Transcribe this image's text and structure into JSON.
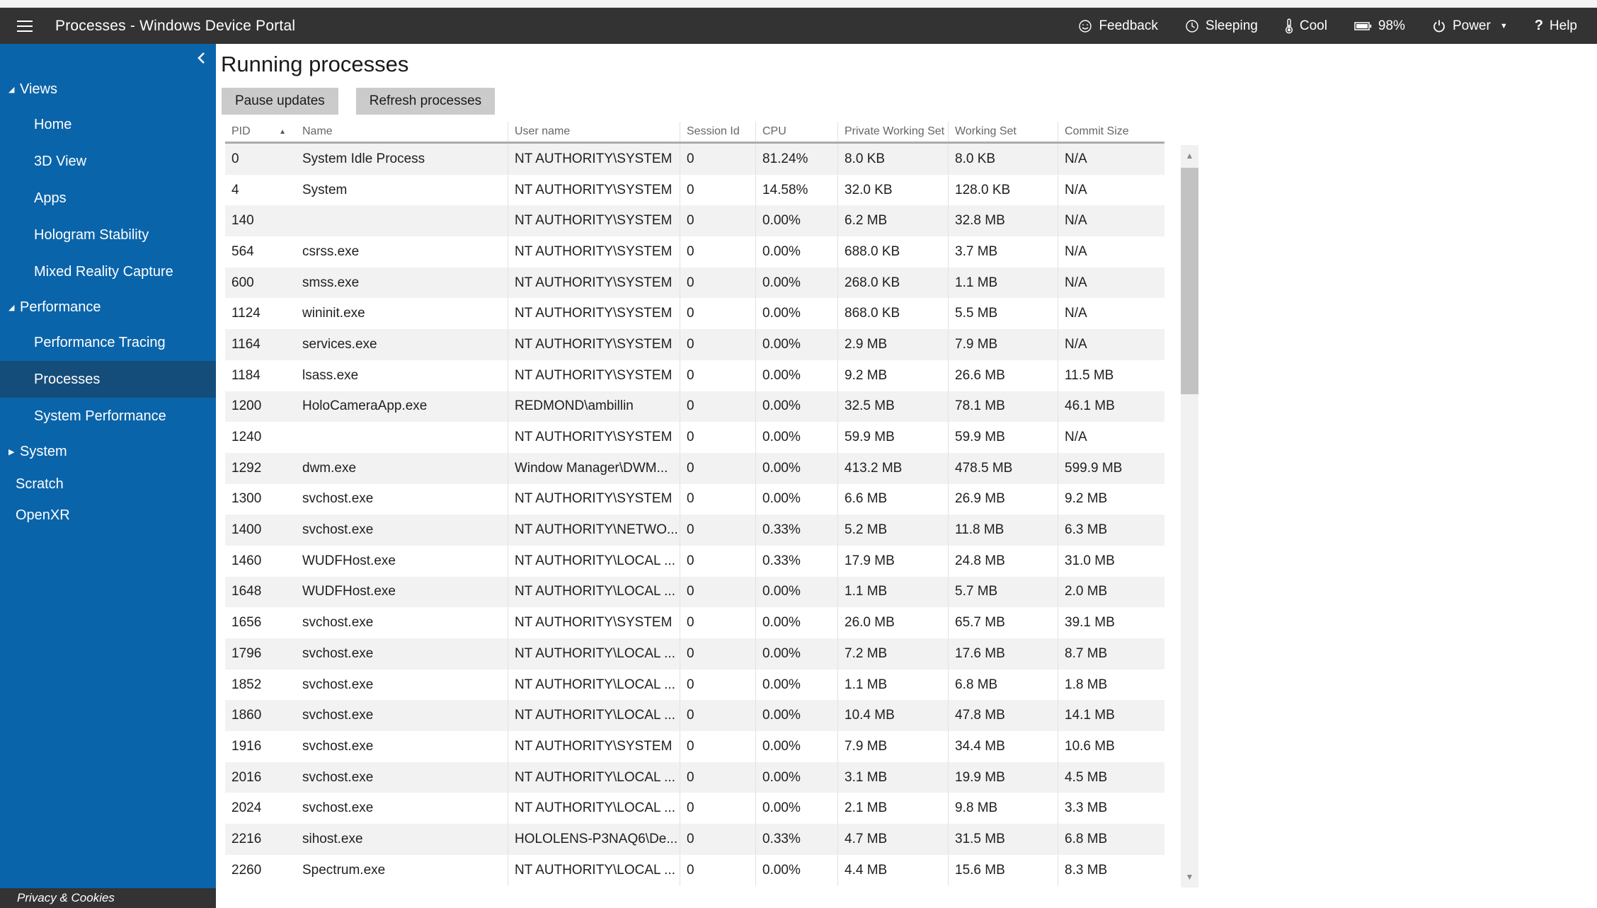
{
  "topbar": {
    "title": "Processes - Windows Device Portal",
    "actions": [
      {
        "icon": "smiley-icon",
        "label": "Feedback"
      },
      {
        "icon": "history-clock-icon",
        "label": "Sleeping"
      },
      {
        "icon": "thermometer-icon",
        "label": "Cool"
      },
      {
        "icon": "battery-icon",
        "label": "98%"
      },
      {
        "icon": "power-icon",
        "label": "Power",
        "has_dropdown": true
      },
      {
        "icon": "question-mark-icon",
        "label": "Help"
      }
    ]
  },
  "sidebar": {
    "items": [
      {
        "label": "Views",
        "kind": "group",
        "state": "expanded"
      },
      {
        "label": "Home",
        "kind": "child"
      },
      {
        "label": "3D View",
        "kind": "child"
      },
      {
        "label": "Apps",
        "kind": "child"
      },
      {
        "label": "Hologram Stability",
        "kind": "child"
      },
      {
        "label": "Mixed Reality Capture",
        "kind": "child"
      },
      {
        "label": "Performance",
        "kind": "group",
        "state": "expanded"
      },
      {
        "label": "Performance Tracing",
        "kind": "child"
      },
      {
        "label": "Processes",
        "kind": "child",
        "selected": true
      },
      {
        "label": "System Performance",
        "kind": "child"
      },
      {
        "label": "System",
        "kind": "group",
        "state": "collapsed"
      },
      {
        "label": "Scratch",
        "kind": "root"
      },
      {
        "label": "OpenXR",
        "kind": "root"
      }
    ],
    "privacy_label": "Privacy & Cookies"
  },
  "main": {
    "title": "Running processes",
    "buttons": [
      {
        "label": "Pause updates"
      },
      {
        "label": "Refresh processes"
      }
    ]
  },
  "table": {
    "sort": {
      "column": "PID",
      "direction": "ascending"
    },
    "columns": [
      "PID",
      "Name",
      "User name",
      "Session Id",
      "CPU",
      "Private Working Set",
      "Working Set",
      "Commit Size"
    ],
    "rows": [
      [
        "0",
        "System Idle Process",
        "NT AUTHORITY\\SYSTEM",
        "0",
        "81.24%",
        "8.0 KB",
        "8.0 KB",
        "N/A"
      ],
      [
        "4",
        "System",
        "NT AUTHORITY\\SYSTEM",
        "0",
        "14.58%",
        "32.0 KB",
        "128.0 KB",
        "N/A"
      ],
      [
        "140",
        "",
        "NT AUTHORITY\\SYSTEM",
        "0",
        "0.00%",
        "6.2 MB",
        "32.8 MB",
        "N/A"
      ],
      [
        "564",
        "csrss.exe",
        "NT AUTHORITY\\SYSTEM",
        "0",
        "0.00%",
        "688.0 KB",
        "3.7 MB",
        "N/A"
      ],
      [
        "600",
        "smss.exe",
        "NT AUTHORITY\\SYSTEM",
        "0",
        "0.00%",
        "268.0 KB",
        "1.1 MB",
        "N/A"
      ],
      [
        "1124",
        "wininit.exe",
        "NT AUTHORITY\\SYSTEM",
        "0",
        "0.00%",
        "868.0 KB",
        "5.5 MB",
        "N/A"
      ],
      [
        "1164",
        "services.exe",
        "NT AUTHORITY\\SYSTEM",
        "0",
        "0.00%",
        "2.9 MB",
        "7.9 MB",
        "N/A"
      ],
      [
        "1184",
        "lsass.exe",
        "NT AUTHORITY\\SYSTEM",
        "0",
        "0.00%",
        "9.2 MB",
        "26.6 MB",
        "11.5 MB"
      ],
      [
        "1200",
        "HoloCameraApp.exe",
        "REDMOND\\ambillin",
        "0",
        "0.00%",
        "32.5 MB",
        "78.1 MB",
        "46.1 MB"
      ],
      [
        "1240",
        "",
        "NT AUTHORITY\\SYSTEM",
        "0",
        "0.00%",
        "59.9 MB",
        "59.9 MB",
        "N/A"
      ],
      [
        "1292",
        "dwm.exe",
        "Window Manager\\DWM...",
        "0",
        "0.00%",
        "413.2 MB",
        "478.5 MB",
        "599.9 MB"
      ],
      [
        "1300",
        "svchost.exe",
        "NT AUTHORITY\\SYSTEM",
        "0",
        "0.00%",
        "6.6 MB",
        "26.9 MB",
        "9.2 MB"
      ],
      [
        "1400",
        "svchost.exe",
        "NT AUTHORITY\\NETWO...",
        "0",
        "0.33%",
        "5.2 MB",
        "11.8 MB",
        "6.3 MB"
      ],
      [
        "1460",
        "WUDFHost.exe",
        "NT AUTHORITY\\LOCAL ...",
        "0",
        "0.33%",
        "17.9 MB",
        "24.8 MB",
        "31.0 MB"
      ],
      [
        "1648",
        "WUDFHost.exe",
        "NT AUTHORITY\\LOCAL ...",
        "0",
        "0.00%",
        "1.1 MB",
        "5.7 MB",
        "2.0 MB"
      ],
      [
        "1656",
        "svchost.exe",
        "NT AUTHORITY\\SYSTEM",
        "0",
        "0.00%",
        "26.0 MB",
        "65.7 MB",
        "39.1 MB"
      ],
      [
        "1796",
        "svchost.exe",
        "NT AUTHORITY\\LOCAL ...",
        "0",
        "0.00%",
        "7.2 MB",
        "17.6 MB",
        "8.7 MB"
      ],
      [
        "1852",
        "svchost.exe",
        "NT AUTHORITY\\LOCAL ...",
        "0",
        "0.00%",
        "1.1 MB",
        "6.8 MB",
        "1.8 MB"
      ],
      [
        "1860",
        "svchost.exe",
        "NT AUTHORITY\\LOCAL ...",
        "0",
        "0.00%",
        "10.4 MB",
        "47.8 MB",
        "14.1 MB"
      ],
      [
        "1916",
        "svchost.exe",
        "NT AUTHORITY\\SYSTEM",
        "0",
        "0.00%",
        "7.9 MB",
        "34.4 MB",
        "10.6 MB"
      ],
      [
        "2016",
        "svchost.exe",
        "NT AUTHORITY\\LOCAL ...",
        "0",
        "0.00%",
        "3.1 MB",
        "19.9 MB",
        "4.5 MB"
      ],
      [
        "2024",
        "svchost.exe",
        "NT AUTHORITY\\LOCAL ...",
        "0",
        "0.00%",
        "2.1 MB",
        "9.8 MB",
        "3.3 MB"
      ],
      [
        "2216",
        "sihost.exe",
        "HOLOLENS-P3NAQ6\\De...",
        "0",
        "0.33%",
        "4.7 MB",
        "31.5 MB",
        "6.8 MB"
      ],
      [
        "2260",
        "Spectrum.exe",
        "NT AUTHORITY\\LOCAL ...",
        "0",
        "0.00%",
        "4.4 MB",
        "15.6 MB",
        "8.3 MB"
      ]
    ]
  },
  "colors": {
    "topbar_bg": "#333333",
    "sidebar_bg": "#0a64aa",
    "sidebar_selected_bg": "#154d7a",
    "row_stripe": "#f2f2f2"
  }
}
